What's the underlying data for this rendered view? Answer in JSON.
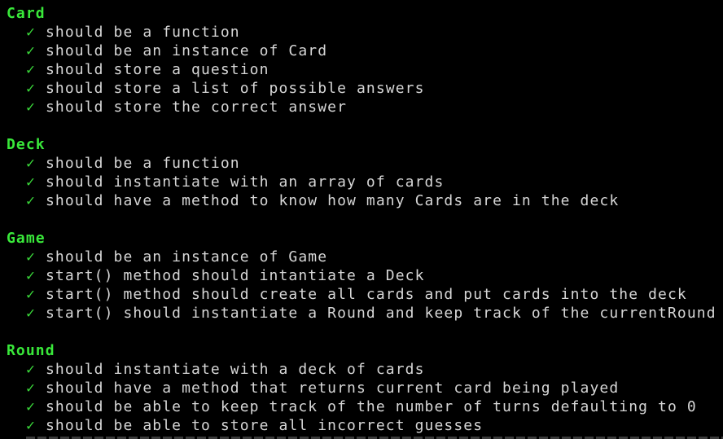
{
  "theme": {
    "background": "#000000",
    "suite_color": "#39e83a",
    "check_color": "#3ad83a",
    "text_color": "#d6d6d6"
  },
  "check_mark": "✓",
  "suites": [
    {
      "title": "Card",
      "tests": [
        "should be a function",
        "should be an instance of Card",
        "should store a question",
        "should store a list of possible answers",
        "should store the correct answer"
      ]
    },
    {
      "title": "Deck",
      "tests": [
        "should be a function",
        "should instantiate with an array of cards",
        "should have a method to know how many Cards are in the deck"
      ]
    },
    {
      "title": "Game",
      "tests": [
        "should be an instance of Game",
        "start() method should intantiate a Deck",
        "start() method should create all cards and put cards into the deck",
        "start() should instantiate a Round and keep track of the currentRound"
      ]
    },
    {
      "title": "Round",
      "tests": [
        "should instantiate with a deck of cards",
        "should have a method that returns current card being played",
        "should be able to keep track of the number of turns defaulting to 0",
        "should be able to store all incorrect guesses"
      ]
    }
  ]
}
